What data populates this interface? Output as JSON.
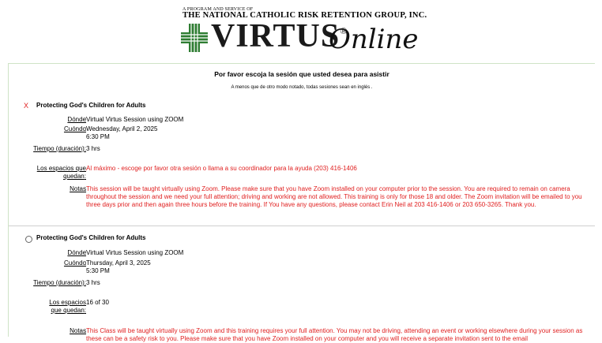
{
  "header": {
    "program_line": "A PROGRAM AND SERVICE OF",
    "org_name": "THE NATIONAL CATHOLIC RISK RETENTION GROUP, INC.",
    "logo_word": "VIRTUS",
    "logo_reg": "®",
    "logo_online": "Online"
  },
  "page": {
    "title": "Por favor escoja la sesión que usted desea para asistir",
    "subtitle": "A menos que de otro modo notado, todas sesiones sean en inglés ."
  },
  "labels": {
    "where": "Dónde",
    "when": "Cuóndo",
    "time": "Tiempo (duración)",
    "spaces_left": "Los espacios que quedan",
    "notes": "Notas"
  },
  "sessions": [
    {
      "selected_mark": "X",
      "name": "Protecting God's Children for Adults",
      "where": "Virtual Virtus Session using ZOOM",
      "date": "Wednesday, April 2, 2025",
      "time": "6:30 PM",
      "duration": "3 hrs",
      "spaces": "Al máximo - escoge por favor otra sesión o llama a su coordinador para la ayuda (203) 416-1406",
      "notes": "This session will be taught virtually using Zoom. Please make sure that you have Zoom installed on your computer prior to the session. You are required to remain on camera throughout the session and we need your full attention; driving and working are not allowed. This training is only for those 18 and older. The Zoom invitation will be emailed to you three days prior and then again three hours before the training. If You have any questions, please contact Erin Neil at 203 416-1406 or 203 650-3265. Thank you."
    },
    {
      "name": "Protecting God's Children for Adults",
      "where": "Virtual Virtus Session using ZOOM",
      "date": "Thursday, April 3, 2025",
      "time": "5:30 PM",
      "duration": "3 hrs",
      "spaces": "16 of 30",
      "notes": "This Class will be taught virtually using Zoom and this training requires your full attention. You may not be driving, attending an event or working elsewhere during your session as these can be a safety risk to you. Please make sure that you have Zoom installed on your computer and you will receive a separate invitation sent to the email"
    }
  ],
  "colors": {
    "accent_red": "#e02020",
    "panel_border": "#cfe3c6"
  }
}
